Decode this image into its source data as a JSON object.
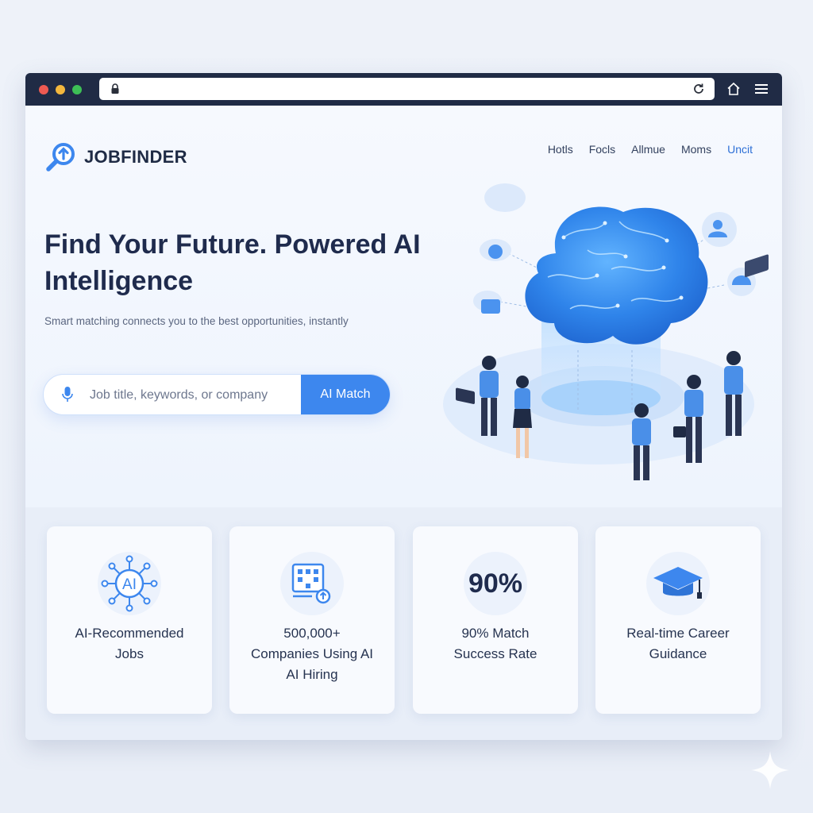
{
  "brand": {
    "name": "JOBFINDER"
  },
  "nav": {
    "items": [
      "Hotls",
      "Focls",
      "Allmue",
      "Moms",
      "Uncit"
    ]
  },
  "hero": {
    "headline": "Find Your Future. Powered AI Intelligence",
    "subheadline": "Smart matching connects you to the best opportunities, instantly"
  },
  "search": {
    "placeholder": "Job title, keywords, or company",
    "value": "",
    "button_label": "AI Match"
  },
  "cards": [
    {
      "icon": "ai-network-icon",
      "label": "AI-Recommended\nJobs"
    },
    {
      "icon": "matching-board-icon",
      "label": "500,000+\nCompanies Using AI\nAI Hiring"
    },
    {
      "stat": "90%",
      "label": "90% Match\nSuccess Rate"
    },
    {
      "icon": "graduation-cap-icon",
      "label": "Real-time Career\nGuidance"
    }
  ],
  "colors": {
    "accent": "#3d87ee",
    "chrome": "#202b45",
    "heading": "#1f2b4d",
    "nav_accent": "#2d6fd6"
  }
}
